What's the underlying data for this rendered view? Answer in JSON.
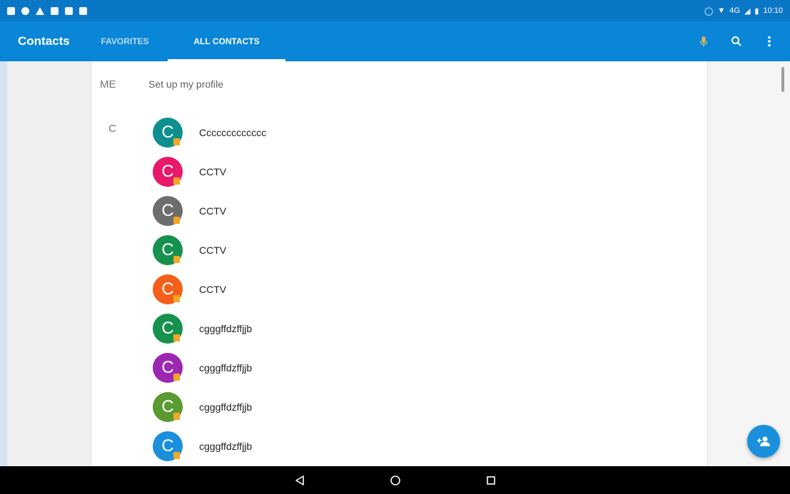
{
  "status_bar": {
    "time": "10:10",
    "network": "4G"
  },
  "app_bar": {
    "title": "Contacts",
    "tabs": [
      {
        "label": "FAVORITES",
        "selected": false
      },
      {
        "label": "ALL CONTACTS",
        "selected": true
      }
    ]
  },
  "me": {
    "label": "ME",
    "text": "Set up my profile"
  },
  "section": {
    "letter": "C"
  },
  "contacts": [
    {
      "initial": "C",
      "name": "Ccccccccccccc",
      "color": "#0e8f8f"
    },
    {
      "initial": "C",
      "name": "CCTV",
      "color": "#e6196b"
    },
    {
      "initial": "C",
      "name": "CCTV",
      "color": "#6d6d6d"
    },
    {
      "initial": "C",
      "name": "CCTV",
      "color": "#16914e"
    },
    {
      "initial": "C",
      "name": "CCTV",
      "color": "#f4601a"
    },
    {
      "initial": "C",
      "name": "cgggffdzffjjb",
      "color": "#16914e"
    },
    {
      "initial": "C",
      "name": "cgggffdzffjjb",
      "color": "#9c27b0"
    },
    {
      "initial": "C",
      "name": "cgggffdzffjjb",
      "color": "#5a9a30"
    },
    {
      "initial": "C",
      "name": "cgggffdzffjjb",
      "color": "#1a8fdc"
    }
  ],
  "colors": {
    "status_bar": "#0a77c6",
    "app_bar": "#0a86d8",
    "fab": "#1a8fdc",
    "badge": "#f5a623"
  },
  "icons": [
    "mic-icon",
    "search-icon",
    "more-vert-icon",
    "add-contact-icon",
    "back-icon",
    "home-icon",
    "recents-icon"
  ]
}
